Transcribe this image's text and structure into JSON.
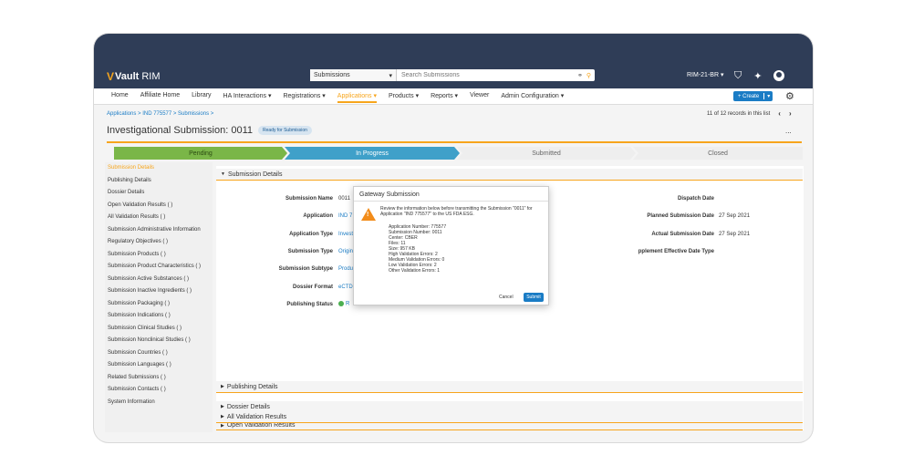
{
  "app": {
    "logo_v": "V",
    "logo_vault": "Vault",
    "logo_rim": "RIM"
  },
  "search": {
    "scope": "Submissions",
    "placeholder": "Search Submissions"
  },
  "user_menu": "RIM-21-BR ▾",
  "nav": {
    "items": [
      "Home",
      "Affiliate Home",
      "Library",
      "HA Interactions ▾",
      "Registrations ▾",
      "Applications ▾",
      "Products ▾",
      "Reports ▾",
      "Viewer",
      "Admin Configuration ▾"
    ],
    "create_label": "+ Create",
    "create_caret": "▾"
  },
  "breadcrumb": "Applications > IND 775577 > Submissions >",
  "records": {
    "text": "11 of 12 records in this list",
    "prev": "‹",
    "next": "›"
  },
  "page": {
    "title": "Investigational Submission: 0011",
    "status_badge": "Ready for Submission",
    "more": "..."
  },
  "stages": [
    "Pending",
    "In Progress",
    "Submitted",
    "Closed"
  ],
  "sidebar": {
    "items": [
      "Submission Details",
      "Publishing Details",
      "Dossier Details",
      "Open Validation Results ( )",
      "All Validation Results ( )",
      "Submission Administrative Information",
      "Regulatory Objectives ( )",
      "Submission Products ( )",
      "Submission Product Characteristics ( )",
      "Submission Active Substances ( )",
      "Submission Inactive Ingredients ( )",
      "Submission Packaging ( )",
      "Submission Indications ( )",
      "Submission Clinical Studies ( )",
      "Submission Nonclinical Studies ( )",
      "Submission Countries ( )",
      "Submission Languages ( )",
      "Related Submissions ( )",
      "Submission Contacts ( )",
      "System Information"
    ]
  },
  "sections": {
    "submission_details": "Submission Details",
    "publishing_details": "Publishing Details",
    "dossier_details": "Dossier Details",
    "open_validation": "Open Validation Results",
    "all_validation": "All Validation Results"
  },
  "fields": {
    "submission_name": {
      "label": "Submission Name",
      "value": "0011"
    },
    "application": {
      "label": "Application",
      "value": "IND 7"
    },
    "application_type": {
      "label": "Application Type",
      "value": "Invest"
    },
    "submission_type": {
      "label": "Submission Type",
      "value": "Origin"
    },
    "submission_subtype": {
      "label": "Submission Subtype",
      "value": "Produ"
    },
    "dossier_format": {
      "label": "Dossier Format",
      "value": "eCTD"
    },
    "publishing_status": {
      "label": "Publishing Status",
      "value": "R"
    },
    "dispatch_date": {
      "label": "Dispatch Date",
      "value": ""
    },
    "planned_date": {
      "label": "Planned Submission Date",
      "value": "27 Sep 2021"
    },
    "actual_date": {
      "label": "Actual Submission Date",
      "value": "27 Sep 2021"
    },
    "supplement_date_type": {
      "label": "pplement Effective Date Type",
      "value": ""
    }
  },
  "modal": {
    "title": "Gateway Submission",
    "intro": "Review the information below before transmitting the Submission \"0011\" for Application \"IND 775577\" to the US FDA ESG.",
    "details": [
      "Application Number: 775577",
      "Submission Number: 0011",
      "Center: CBER",
      "Files: 11",
      "Size: 957 KB",
      "High Validation Errors: 2",
      "Medium Validation Errors: 0",
      "Low Validation Errors: 2",
      "Other Validation Errors: 1"
    ],
    "cancel": "Cancel",
    "submit": "Submit"
  },
  "colors": {
    "header": "#2f3d57",
    "accent": "#f7a51c",
    "link": "#1a7cc5",
    "pending": "#7ab648",
    "in_progress": "#3fa0c9"
  }
}
